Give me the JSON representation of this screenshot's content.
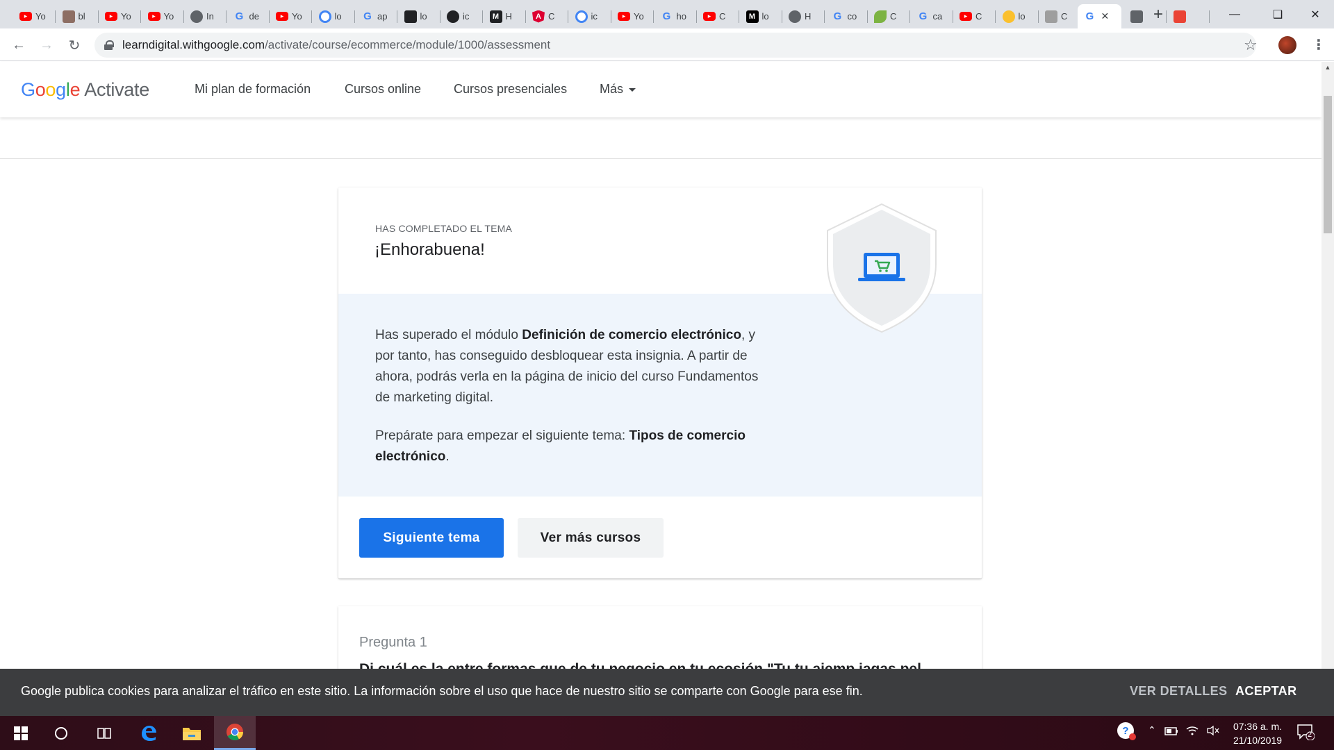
{
  "browser": {
    "tabs": [
      {
        "title": "Yo",
        "icon": "youtube-icon",
        "color": "#ff0000"
      },
      {
        "title": "bl",
        "icon": "person-icon",
        "color": "#8d6e63"
      },
      {
        "title": "Yo",
        "icon": "youtube-icon",
        "color": "#ff0000"
      },
      {
        "title": "Yo",
        "icon": "youtube-icon",
        "color": "#ff0000"
      },
      {
        "title": "In",
        "icon": "globe-icon",
        "color": "#5f6368"
      },
      {
        "title": "de",
        "icon": "google-icon",
        "color": "#4285f4"
      },
      {
        "title": "Yo",
        "icon": "youtube-icon",
        "color": "#ff0000"
      },
      {
        "title": "lo",
        "icon": "circle-icon",
        "color": "#4285f4"
      },
      {
        "title": "ap",
        "icon": "google-icon",
        "color": "#4285f4"
      },
      {
        "title": "lo",
        "icon": "owl-icon",
        "color": "#202124"
      },
      {
        "title": "ic",
        "icon": "github-icon",
        "color": "#202124"
      },
      {
        "title": "H",
        "icon": "m-icon",
        "color": "#202124"
      },
      {
        "title": "C",
        "icon": "angular-icon",
        "color": "#dd0031"
      },
      {
        "title": "ic",
        "icon": "circle-icon",
        "color": "#4285f4"
      },
      {
        "title": "Yo",
        "icon": "youtube-icon",
        "color": "#ff0000"
      },
      {
        "title": "ho",
        "icon": "google-icon",
        "color": "#4285f4"
      },
      {
        "title": "C",
        "icon": "youtube-icon",
        "color": "#ff0000"
      },
      {
        "title": "lo",
        "icon": "medium-icon",
        "color": "#000000"
      },
      {
        "title": "H",
        "icon": "globe-icon",
        "color": "#5f6368"
      },
      {
        "title": "co",
        "icon": "google-icon",
        "color": "#4285f4"
      },
      {
        "title": "C",
        "icon": "leaf-icon",
        "color": "#7cb342"
      },
      {
        "title": "ca",
        "icon": "google-icon",
        "color": "#4285f4"
      },
      {
        "title": "C",
        "icon": "youtube-icon",
        "color": "#ff0000"
      },
      {
        "title": "lo",
        "icon": "emoji-icon",
        "color": "#fbc02d"
      },
      {
        "title": "C",
        "icon": "page-icon",
        "color": "#9e9e9e"
      },
      {
        "title": "",
        "icon": "google-icon",
        "color": "#4285f4",
        "active": true
      },
      {
        "title": "",
        "icon": "rocket-icon",
        "color": "#5f6368"
      },
      {
        "title": "",
        "icon": "key-icon",
        "color": "#ea4335"
      }
    ],
    "url_host": "learndigital.withgoogle.com",
    "url_path": "/activate/course/ecommerce/module/1000/assessment"
  },
  "site": {
    "logo_google": [
      "G",
      "o",
      "o",
      "g",
      "l",
      "e"
    ],
    "logo_product": "Activate",
    "nav": [
      "Mi plan de formación",
      "Cursos online",
      "Cursos presenciales",
      "Más"
    ]
  },
  "card": {
    "eyebrow": "HAS COMPLETADO EL TEMA",
    "title": "¡Enhorabuena!",
    "p1_a": "Has superado el módulo ",
    "p1_b": "Definición de comercio electrónico",
    "p1_c": ", y por tanto, has conseguido desbloquear esta insignia. A partir de ahora, podrás verla en la página de inicio del curso Fundamentos de marketing digital.",
    "p2_a": "Prepárate para empezar el siguiente tema: ",
    "p2_b": "Tipos de comercio electrónico",
    "p2_c": ".",
    "primary_button": "Siguiente tema",
    "secondary_button": "Ver más cursos",
    "badge_icon": "laptop-cart-icon",
    "accent_color": "#1a73e8"
  },
  "question": {
    "label": "Pregunta 1",
    "text": "Di cuál es la entre formas que de tu negocio en tu ecosión \"Tu tu ajemp iagas pel"
  },
  "cookie": {
    "text": "Google publica cookies para analizar el tráfico en este sitio. La información sobre el uso que hace de nuestro sitio se comparte con Google para ese fin.",
    "details": "VER DETALLES",
    "accept": "ACEPTAR"
  },
  "taskbar": {
    "time": "07:36 a. m.",
    "date": "21/10/2019",
    "notifications": "2"
  }
}
